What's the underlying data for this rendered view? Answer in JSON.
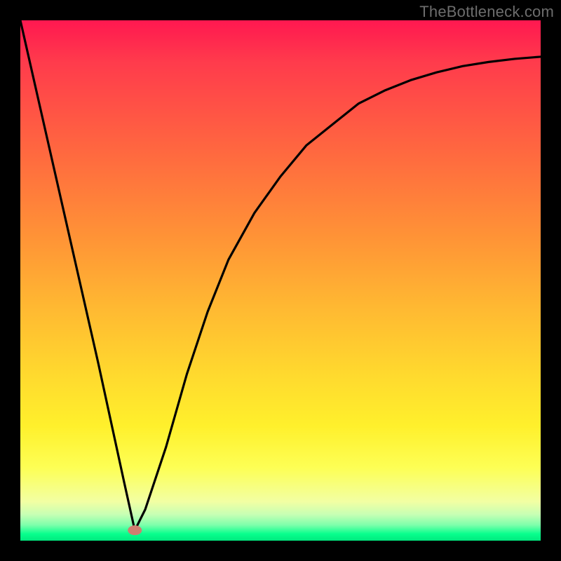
{
  "watermark": "TheBottleneck.com",
  "colors": {
    "frame_border": "#000000",
    "curve": "#000000",
    "marker": "#cf7e70",
    "gradient_top": "#ff1850",
    "gradient_bottom": "#00e97e"
  },
  "chart_data": {
    "type": "line",
    "title": "",
    "xlabel": "",
    "ylabel": "",
    "xlim": [
      0,
      100
    ],
    "ylim": [
      0,
      100
    ],
    "grid": false,
    "legend": false,
    "background": "vertical rainbow gradient red→green",
    "annotations": [
      {
        "type": "point",
        "x": 22,
        "y": 2,
        "color": "#cf7e70",
        "shape": "ellipse"
      }
    ],
    "series": [
      {
        "name": "bottleneck-curve",
        "x": [
          0,
          5,
          10,
          15,
          20,
          22,
          24,
          28,
          32,
          36,
          40,
          45,
          50,
          55,
          60,
          65,
          70,
          75,
          80,
          85,
          90,
          95,
          100
        ],
        "values": [
          100,
          78,
          56,
          34,
          11,
          2,
          6,
          18,
          32,
          44,
          54,
          63,
          70,
          76,
          80,
          84,
          86.5,
          88.5,
          90,
          91.2,
          92,
          92.6,
          93
        ]
      }
    ]
  }
}
